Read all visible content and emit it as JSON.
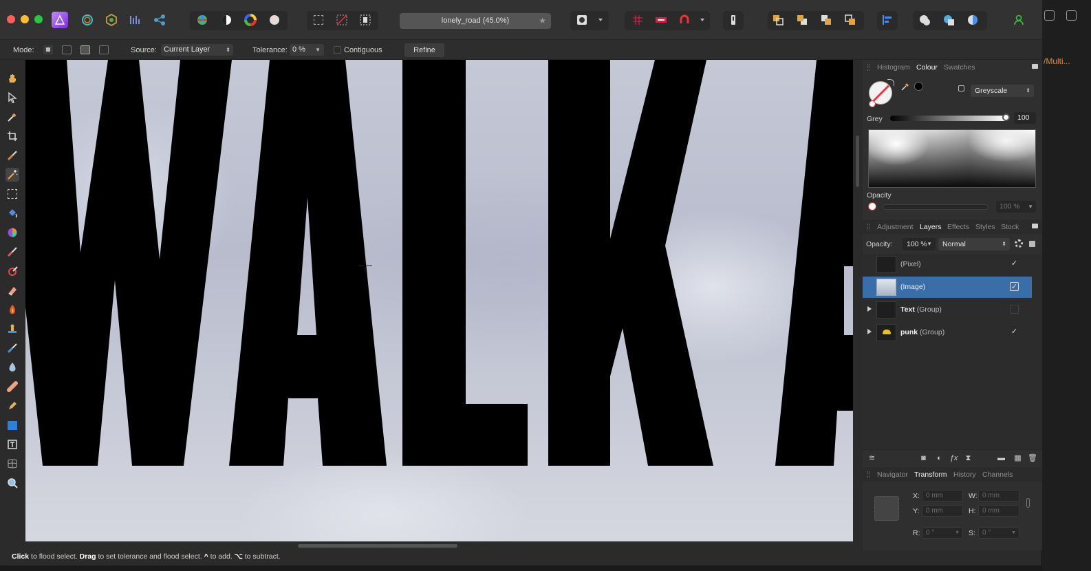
{
  "toolbar": {
    "document_title": "lonely_road (45.0%)",
    "star": "★"
  },
  "context": {
    "mode_label": "Mode:",
    "source_label": "Source:",
    "source_value": "Current Layer",
    "tolerance_label": "Tolerance:",
    "tolerance_value": "0 %",
    "contiguous_label": "Contiguous",
    "refine_label": "Refine"
  },
  "canvas": {
    "text": "WALKA",
    "text_color": "#000000"
  },
  "status": {
    "click": "Click",
    "click_desc": " to flood select. ",
    "drag": "Drag",
    "drag_desc": " to set tolerance and flood select. ",
    "add_key": "^",
    "add_desc": " to add. ",
    "sub_key": "⌥",
    "sub_desc": " to subtract."
  },
  "colour_panel": {
    "tabs": [
      "Histogram",
      "Colour",
      "Swatches"
    ],
    "active_tab": "Colour",
    "model": "Greyscale",
    "grey_label": "Grey",
    "grey_value": "100",
    "opacity_label": "Opacity",
    "opacity_value": "100 %"
  },
  "layers_panel": {
    "tabs": [
      "Adjustment",
      "Layers",
      "Effects",
      "Styles",
      "Stock"
    ],
    "active_tab": "Layers",
    "opacity_label": "Opacity:",
    "opacity_value": "100 %",
    "blend_mode": "Normal",
    "layers": [
      {
        "name": "",
        "type": "(Pixel)",
        "visible": true,
        "selected": false,
        "group": false
      },
      {
        "name": "",
        "type": "(Image)",
        "visible": true,
        "selected": true,
        "group": false
      },
      {
        "name": "Text",
        "type": " (Group)",
        "visible": false,
        "selected": false,
        "group": true
      },
      {
        "name": "punk",
        "type": " (Group)",
        "visible": true,
        "selected": false,
        "group": true
      }
    ]
  },
  "transform_panel": {
    "tabs": [
      "Navigator",
      "Transform",
      "History",
      "Channels"
    ],
    "active_tab": "Transform",
    "x_label": "X:",
    "x_value": "0 mm",
    "y_label": "Y:",
    "y_value": "0 mm",
    "w_label": "W:",
    "w_value": "0 mm",
    "h_label": "H:",
    "h_value": "0 mm",
    "r_label": "R:",
    "r_value": "0 °",
    "s_label": "S:",
    "s_value": "0 °"
  },
  "outside": {
    "folder_text": "/Multi..."
  },
  "colors": {
    "selection": "#3a6ea8",
    "accent_purple": "#9b4dff",
    "close": "#ff5f57",
    "minimize": "#febc2e",
    "zoom": "#28c840"
  }
}
